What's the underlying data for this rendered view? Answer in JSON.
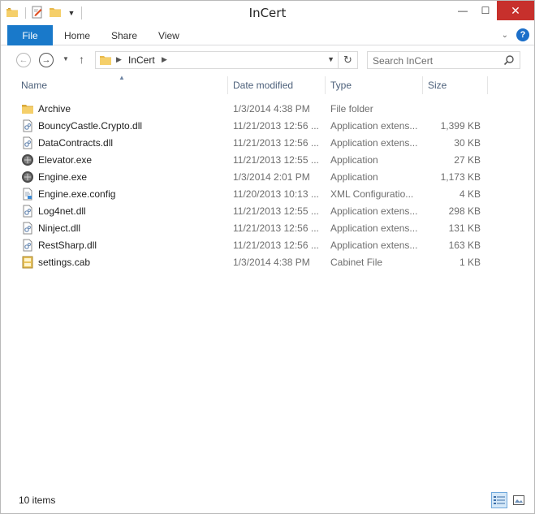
{
  "window": {
    "title": "InCert",
    "controls": {
      "minimize": "—",
      "maximize": "☐",
      "close": "✕"
    }
  },
  "ribbon": {
    "tabs": [
      "File",
      "Home",
      "Share",
      "View"
    ],
    "active_tab": "File",
    "accent_color": "#1979ca",
    "help_label": "?"
  },
  "address": {
    "breadcrumb": [
      "InCert"
    ],
    "search_placeholder": "Search InCert"
  },
  "columns": {
    "name": "Name",
    "date": "Date modified",
    "type": "Type",
    "size": "Size",
    "sorted_by": "Name"
  },
  "files": [
    {
      "icon": "folder-icon",
      "name": "Archive",
      "date": "1/3/2014 4:38 PM",
      "type": "File folder",
      "size": ""
    },
    {
      "icon": "dll-icon",
      "name": "BouncyCastle.Crypto.dll",
      "date": "11/21/2013 12:56 ...",
      "type": "Application extens...",
      "size": "1,399 KB"
    },
    {
      "icon": "dll-icon",
      "name": "DataContracts.dll",
      "date": "11/21/2013 12:56 ...",
      "type": "Application extens...",
      "size": "30 KB"
    },
    {
      "icon": "exe-icon",
      "name": "Elevator.exe",
      "date": "11/21/2013 12:55 ...",
      "type": "Application",
      "size": "27 KB"
    },
    {
      "icon": "exe-icon",
      "name": "Engine.exe",
      "date": "1/3/2014 2:01 PM",
      "type": "Application",
      "size": "1,173 KB"
    },
    {
      "icon": "config-icon",
      "name": "Engine.exe.config",
      "date": "11/20/2013 10:13 ...",
      "type": "XML Configuratio...",
      "size": "4 KB"
    },
    {
      "icon": "dll-icon",
      "name": "Log4net.dll",
      "date": "11/21/2013 12:55 ...",
      "type": "Application extens...",
      "size": "298 KB"
    },
    {
      "icon": "dll-icon",
      "name": "Ninject.dll",
      "date": "11/21/2013 12:56 ...",
      "type": "Application extens...",
      "size": "131 KB"
    },
    {
      "icon": "dll-icon",
      "name": "RestSharp.dll",
      "date": "11/21/2013 12:56 ...",
      "type": "Application extens...",
      "size": "163 KB"
    },
    {
      "icon": "cab-icon",
      "name": "settings.cab",
      "date": "1/3/2014 4:38 PM",
      "type": "Cabinet File",
      "size": "1 KB"
    }
  ],
  "status": {
    "item_count": "10 items",
    "view_mode": "details"
  }
}
